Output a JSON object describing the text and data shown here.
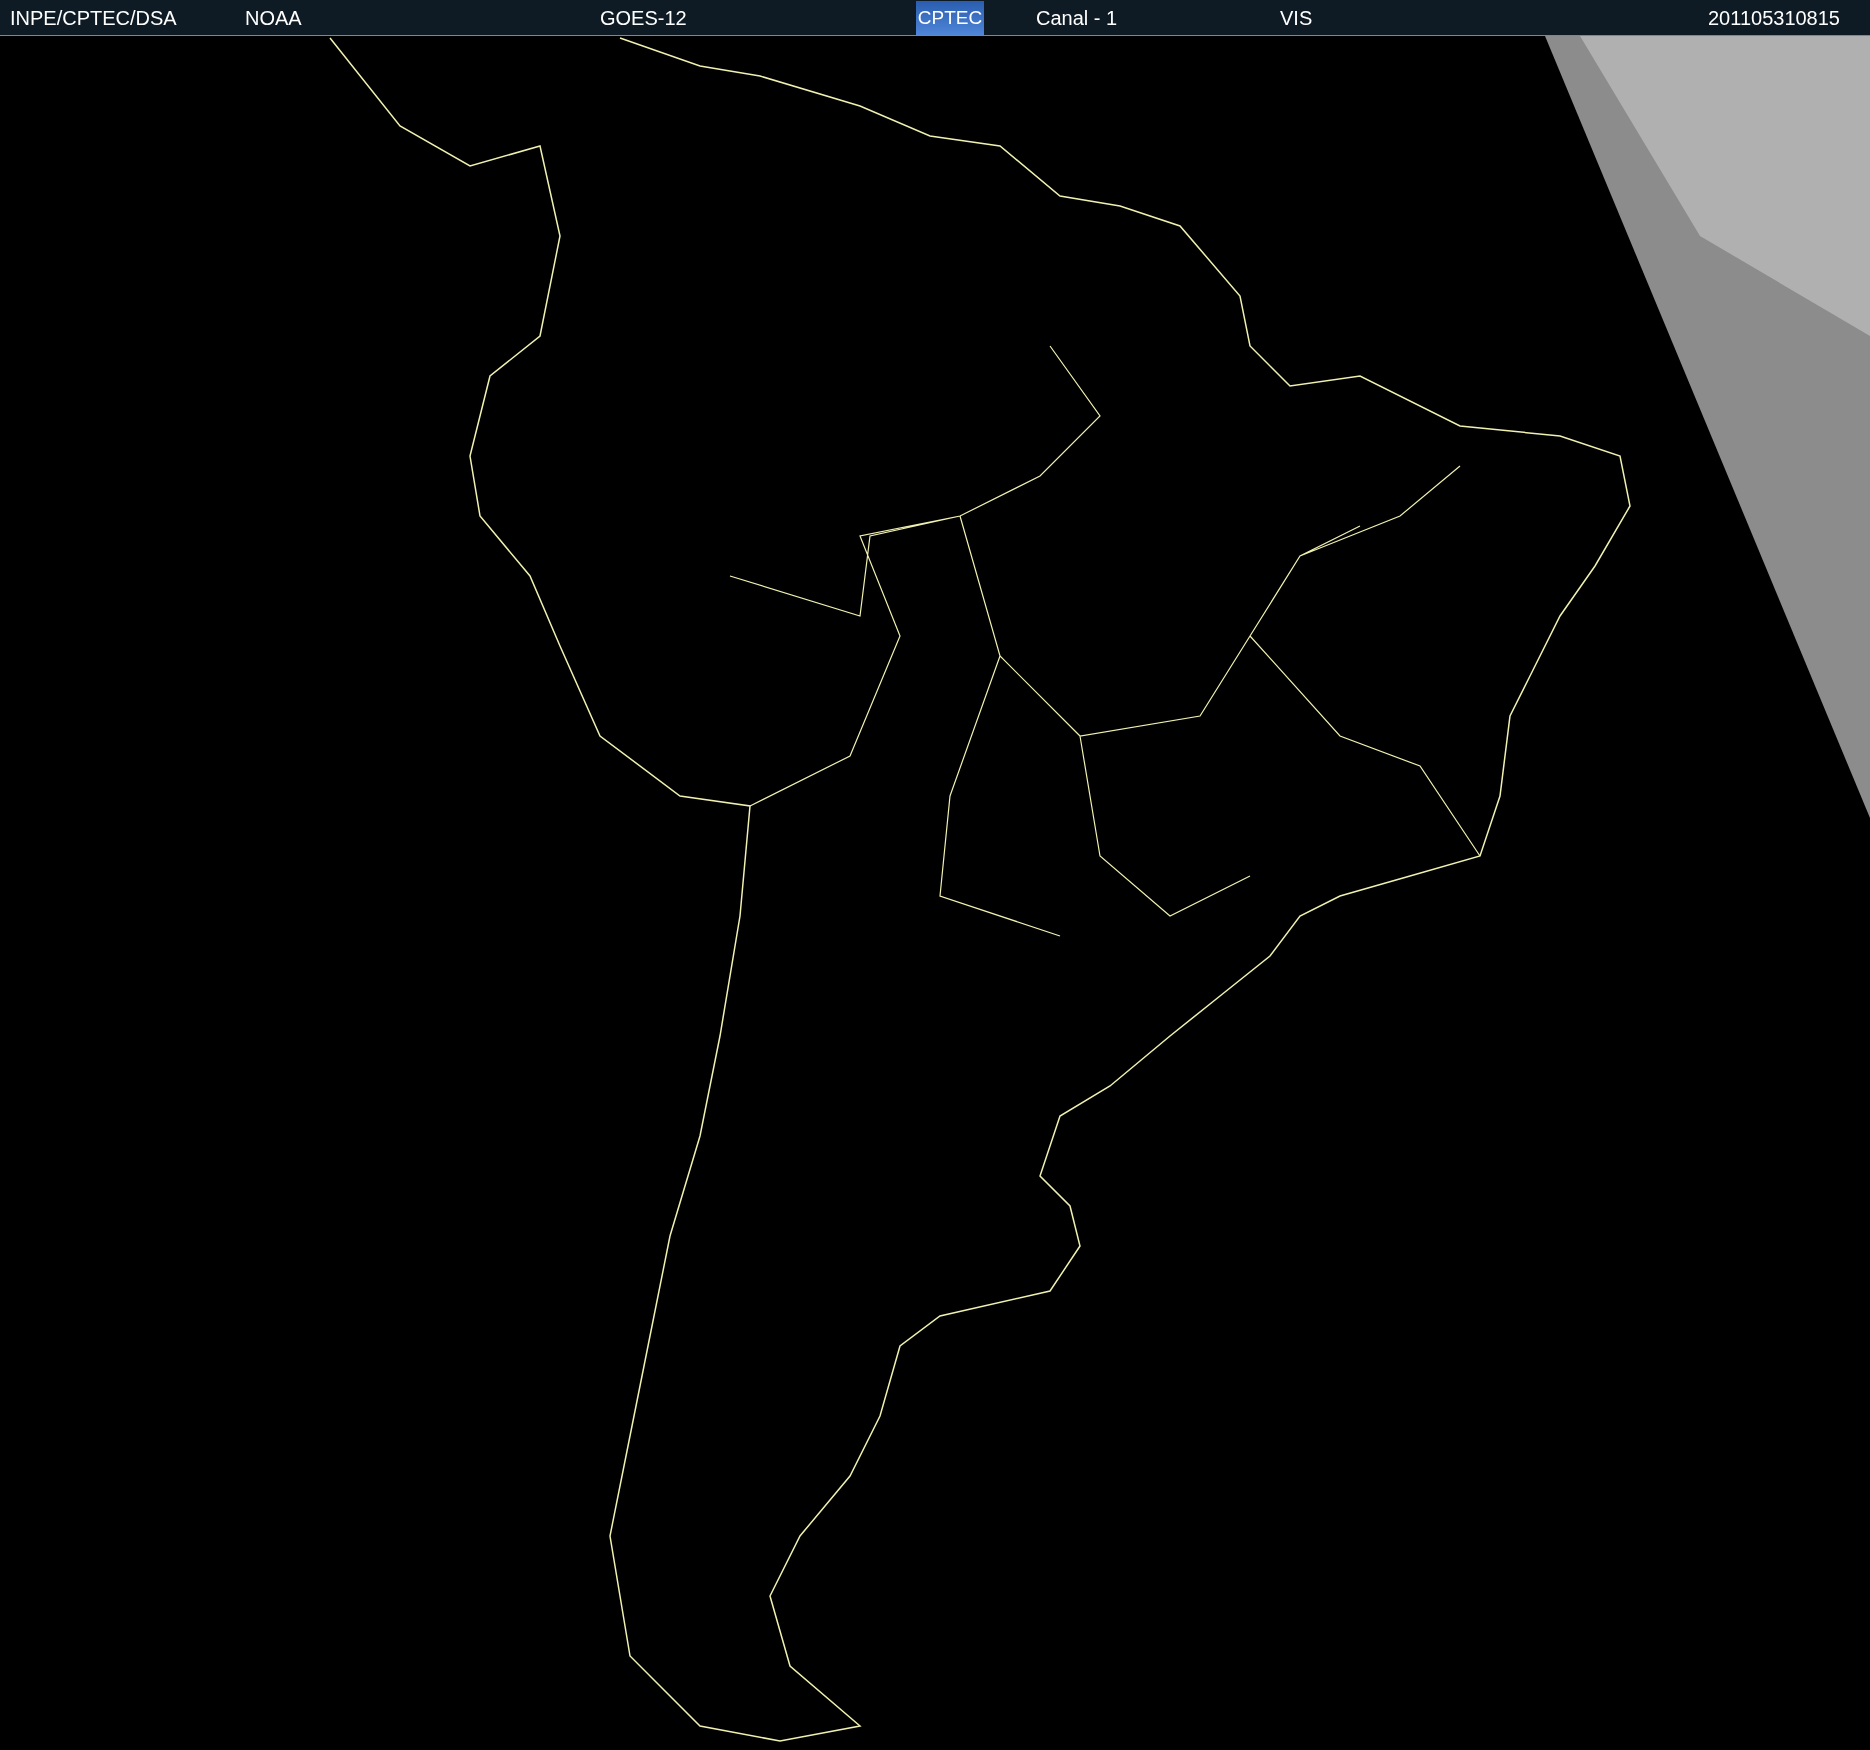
{
  "header": {
    "source": "INPE/CPTEC/DSA",
    "agency": "NOAA",
    "satellite": "GOES-12",
    "logo": "CPTEC",
    "channel": "Canal - 1",
    "band": "VIS",
    "timestamp": "201105310815"
  }
}
